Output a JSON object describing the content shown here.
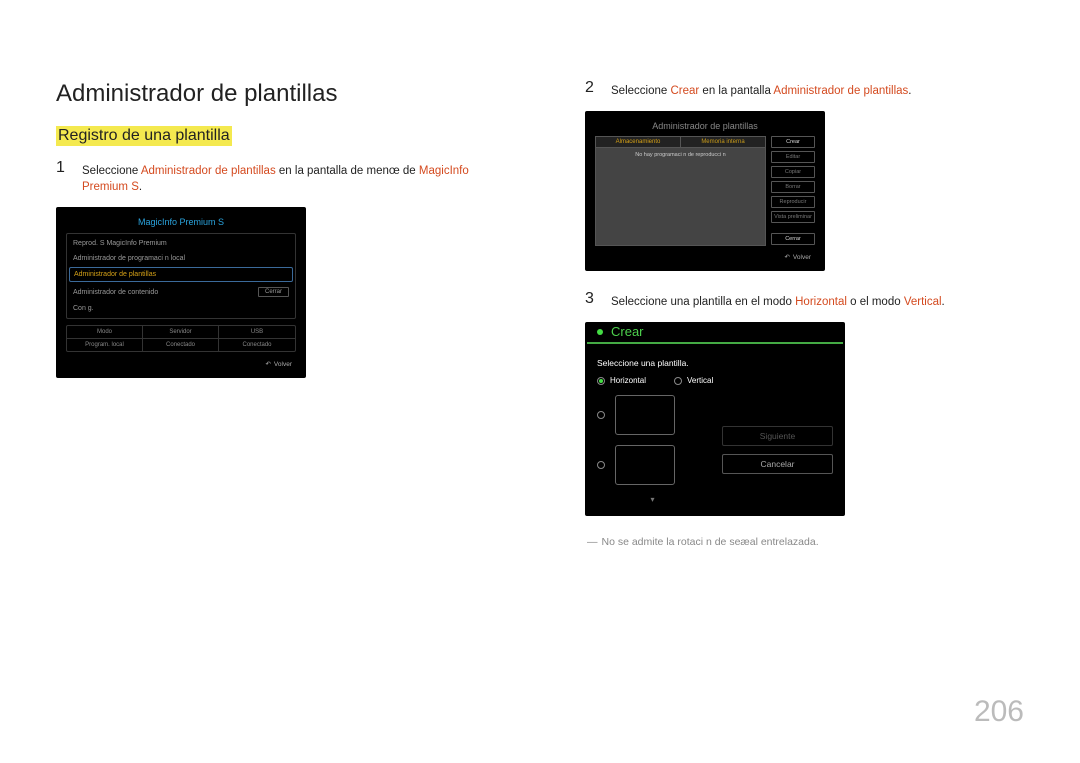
{
  "left": {
    "h1": "Administrador de plantillas",
    "h2": "Registro de una plantilla",
    "step1": {
      "num": "1",
      "pre": "Seleccione ",
      "hl1": "Administrador de plantillas",
      "mid": " en la pantalla de menœ de ",
      "hl2": "MagicInfo Premium S",
      "post": "."
    },
    "panel1": {
      "title": "MagicInfo Premium S",
      "items": [
        "Reprod. S MagicInfo Premium",
        "Administrador de programaci n local",
        "Administrador de plantillas",
        "Administrador de contenido",
        "Con g."
      ],
      "close": "Cerrar",
      "grid": [
        "Modo",
        "Servidor",
        "USB",
        "Program. local",
        "Conectado",
        "Conectado"
      ],
      "return": "Volver"
    }
  },
  "right": {
    "step2": {
      "num": "2",
      "pre": "Seleccione ",
      "hl1": "Crear",
      "mid": " en la pantalla ",
      "hl2": "Administrador de plantillas",
      "post": "."
    },
    "panel2": {
      "title": "Administrador de plantillas",
      "tabs": [
        "Almacenamiento",
        "Memoria interna"
      ],
      "msg": "No hay programaci n de reproducci n",
      "side": [
        "Crear",
        "Editar",
        "Copiar",
        "Borrar",
        "Reproducir",
        "Vista preliminar",
        "Cerrar"
      ],
      "return": "Volver"
    },
    "step3": {
      "num": "3",
      "pre": "Seleccione una plantilla en el modo ",
      "hl1": "Horizontal",
      "mid": " o el modo ",
      "hl2": "Vertical",
      "post": "."
    },
    "panel3": {
      "title": "Crear",
      "sub": "Seleccione una plantilla.",
      "radioH": "Horizontal",
      "radioV": "Vertical",
      "next": "Siguiente",
      "cancel": "Cancelar"
    },
    "note": "No se admite la rotaci n de seæal entrelazada."
  },
  "page": "206"
}
